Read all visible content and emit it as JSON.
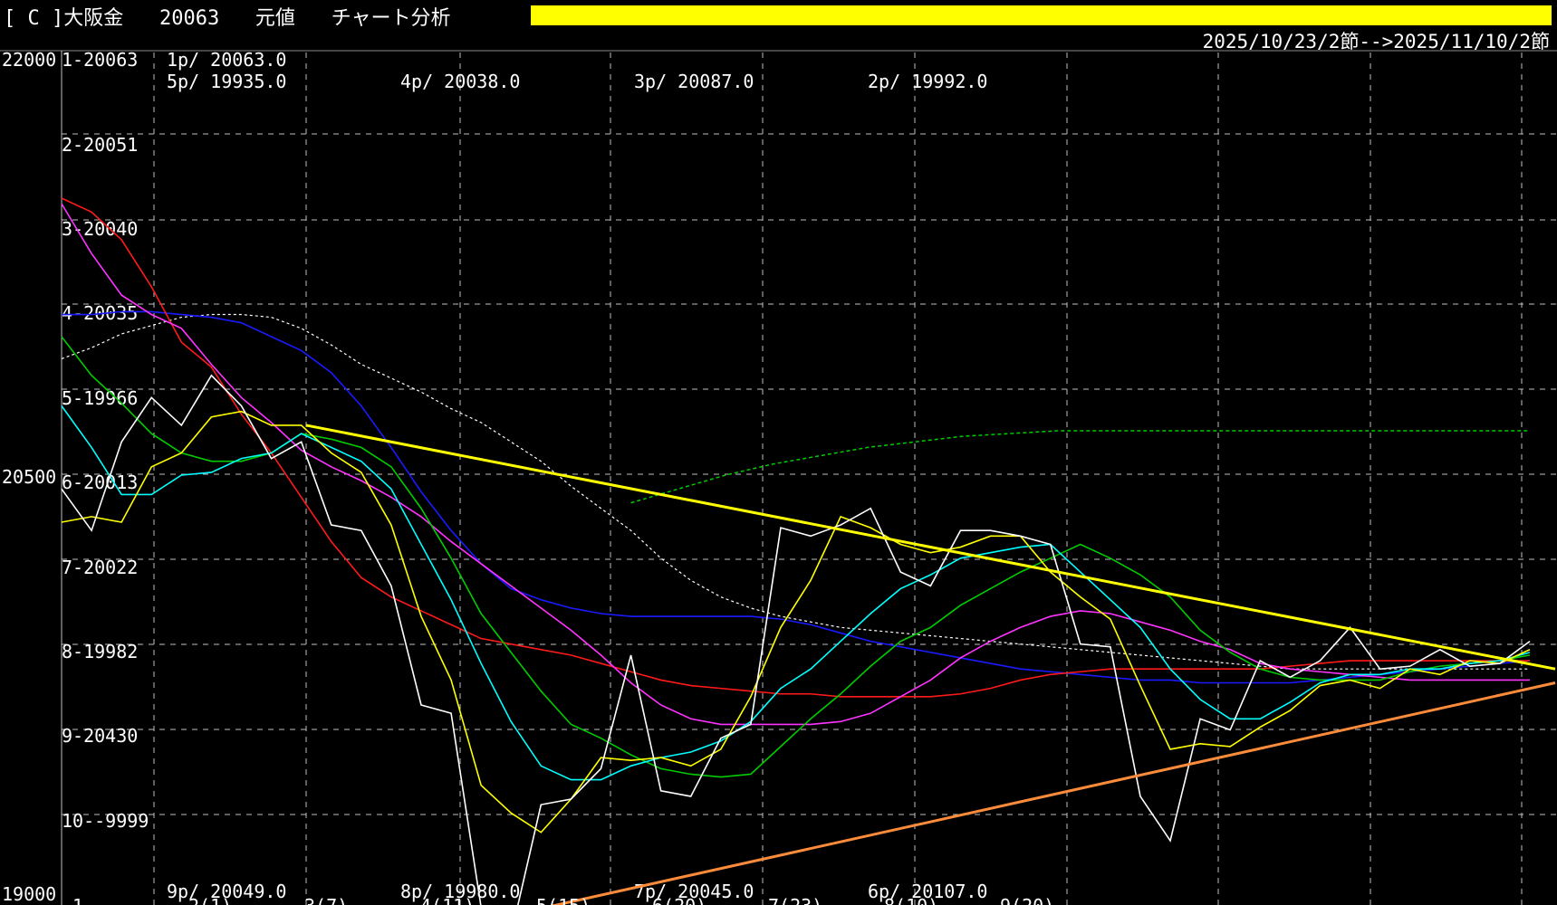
{
  "header": {
    "title": "[ C ]大阪金   20063   元値   チャート分析",
    "date_range": "2025/10/23/2節-->2025/11/10/2節"
  },
  "colors": {
    "background": "#000000",
    "grid": "#bfbfbf",
    "accent_bar": "#ffff00",
    "resistance_line": "#ffff00",
    "support_line": "#ff8c3a"
  },
  "chart_data": {
    "type": "line",
    "y_axis_labels": [
      "22000",
      "20500",
      "19000"
    ],
    "y_range": [
      19000,
      22000
    ],
    "grid": true,
    "price_levels": [
      "1-20063",
      "2-20051",
      "3-20040",
      "4-20035",
      "5-19966",
      "6-20013",
      "7-20022",
      "8-19982",
      "9-20430",
      "10--9999"
    ],
    "points_top": [
      "1p/ 20063.0",
      "5p/ 19935.0",
      "4p/ 20038.0",
      "3p/ 20087.0",
      "2p/ 19992.0"
    ],
    "points_bottom": [
      "9p/ 20049.0",
      "8p/ 19980.0",
      "7p/ 20045.0",
      "6p/ 20107.0"
    ],
    "series": [
      {
        "color": "#ffffff",
        "values": [
          20450,
          20300,
          20620,
          20780,
          20680,
          20860,
          20750,
          20560,
          20620,
          20320,
          20300,
          20100,
          19670,
          19640,
          18940,
          18840,
          19310,
          19330,
          19440,
          19850,
          19360,
          19340,
          19550,
          19600,
          20310,
          20280,
          20320,
          20380,
          20150,
          20100,
          20300,
          20300,
          20280,
          20250,
          19890,
          19880,
          19340,
          19180,
          19620,
          19580,
          19830,
          19770,
          19830,
          19950,
          19800,
          19810,
          19870,
          19810,
          19820,
          19900
        ]
      },
      {
        "color": "#ffff00",
        "values": [
          20330,
          20350,
          20330,
          20530,
          20580,
          20710,
          20730,
          20680,
          20680,
          20580,
          20510,
          20320,
          19990,
          19760,
          19380,
          19280,
          19210,
          19330,
          19480,
          19470,
          19480,
          19450,
          19510,
          19700,
          19950,
          20120,
          20350,
          20310,
          20250,
          20220,
          20240,
          20280,
          20280,
          20150,
          20060,
          19980,
          19740,
          19510,
          19530,
          19520,
          19590,
          19650,
          19740,
          19760,
          19730,
          19800,
          19780,
          19830,
          19820,
          19870
        ]
      },
      {
        "color": "#00ffff",
        "values": [
          20750,
          20600,
          20430,
          20430,
          20500,
          20510,
          20560,
          20580,
          20650,
          20600,
          20550,
          20450,
          20250,
          20050,
          19820,
          19610,
          19450,
          19400,
          19400,
          19450,
          19480,
          19500,
          19540,
          19610,
          19730,
          19800,
          19900,
          20000,
          20090,
          20140,
          20200,
          20220,
          20240,
          20250,
          20150,
          20050,
          19950,
          19800,
          19690,
          19620,
          19620,
          19680,
          19750,
          19780,
          19780,
          19800,
          19800,
          19820,
          19830,
          19860
        ]
      },
      {
        "color": "#00cc00",
        "values": [
          21000,
          20860,
          20760,
          20650,
          20580,
          20550,
          20550,
          20580,
          20650,
          20630,
          20600,
          20530,
          20380,
          20200,
          20000,
          19860,
          19720,
          19600,
          19550,
          19490,
          19440,
          19420,
          19410,
          19420,
          19520,
          19620,
          19710,
          19810,
          19900,
          19950,
          20030,
          20090,
          20150,
          20200,
          20250,
          20200,
          20140,
          20060,
          19940,
          19860,
          19800,
          19770,
          19760,
          19760,
          19760,
          19790,
          19810,
          19820,
          19830,
          19850
        ]
      },
      {
        "color": "#ff33ff",
        "values": [
          21480,
          21300,
          21150,
          21080,
          21030,
          20900,
          20780,
          20690,
          20590,
          20530,
          20480,
          20420,
          20350,
          20260,
          20180,
          20100,
          20020,
          19940,
          19850,
          19750,
          19670,
          19620,
          19600,
          19600,
          19600,
          19600,
          19610,
          19640,
          19700,
          19760,
          19840,
          19900,
          19950,
          19990,
          20010,
          20000,
          19970,
          19940,
          19900,
          19870,
          19820,
          19800,
          19790,
          19780,
          19770,
          19760,
          19760,
          19760,
          19760,
          19760
        ]
      },
      {
        "color": "#ff1a1a",
        "values": [
          21500,
          21450,
          21350,
          21180,
          20980,
          20890,
          20720,
          20580,
          20420,
          20260,
          20130,
          20060,
          20010,
          19960,
          19910,
          19890,
          19870,
          19850,
          19820,
          19790,
          19760,
          19740,
          19730,
          19720,
          19710,
          19710,
          19700,
          19700,
          19700,
          19700,
          19710,
          19730,
          19760,
          19780,
          19790,
          19800,
          19800,
          19800,
          19800,
          19800,
          19800,
          19810,
          19820,
          19830,
          19830,
          19830,
          19830,
          19830,
          19830,
          19830
        ]
      },
      {
        "color": "#1a1aff",
        "values": [
          21080,
          21080,
          21090,
          21090,
          21080,
          21070,
          21050,
          21000,
          20950,
          20870,
          20750,
          20600,
          20440,
          20300,
          20180,
          20090,
          20050,
          20020,
          20000,
          19990,
          19990,
          19990,
          19990,
          19990,
          19980,
          19960,
          19930,
          19900,
          19880,
          19860,
          19840,
          19820,
          19800,
          19790,
          19780,
          19770,
          19760,
          19760,
          19750,
          19750,
          19750,
          19750,
          19760,
          19770,
          19780,
          19790,
          19800,
          19810,
          19820,
          19830
        ]
      }
    ],
    "moving_average_white_dashed": [
      20920,
      20960,
      21010,
      21040,
      21070,
      21080,
      21080,
      21070,
      21030,
      20970,
      20900,
      20850,
      20800,
      20740,
      20690,
      20620,
      20550,
      20460,
      20380,
      20300,
      20200,
      20120,
      20060,
      20020,
      19990,
      19970,
      19950,
      19940,
      19930,
      19920,
      19910,
      19900,
      19890,
      19880,
      19870,
      19860,
      19850,
      19840,
      19830,
      19820,
      19810,
      19800,
      19800,
      19800,
      19800,
      19800,
      19800,
      19800,
      19800,
      19800
    ],
    "moving_average_green_dashed": [
      20400,
      20450,
      20500,
      20540,
      20570,
      20600,
      20620,
      20640,
      20650,
      20660,
      20660,
      20660,
      20660,
      20660,
      20660,
      20660,
      20660,
      20660,
      20660,
      20660
    ],
    "trendlines": [
      {
        "name": "resistance",
        "from": [
          20600,
          20680
        ],
        "to": [
          49,
          19800
        ]
      },
      {
        "name": "support",
        "from": [
          13,
          18860
        ],
        "to": [
          49,
          19750
        ]
      }
    ],
    "x_axis_labels": [
      "1",
      "2(1)",
      "3(7)",
      "4(11)",
      "5(15)",
      "6(20)",
      "7(23)",
      "8(10)",
      "9(20)"
    ]
  }
}
